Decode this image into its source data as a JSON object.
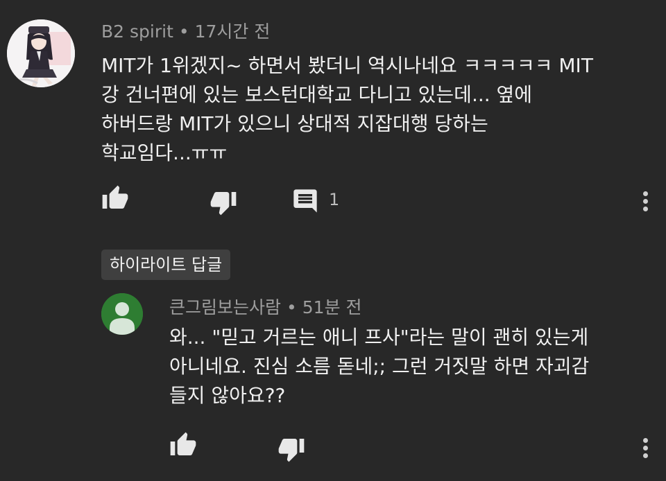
{
  "comment": {
    "author": "B2 spirit",
    "separator": "•",
    "time": "17시간 전",
    "lines": [
      "MIT가 1위겠지~ 하면서 봤더니 역시나네요 ㅋㅋㅋㅋㅋ MIT",
      "강 건너편에 있는 보스턴대학교 다니고 있는데... 옆에",
      "하버드랑 MIT가 있으니 상대적 지잡대행 당하는",
      "학교임다...ㅠㅠ"
    ],
    "reply_count": "1"
  },
  "highlight_label": "하이라이트 답글",
  "reply": {
    "author": "큰그림보는사람",
    "separator": "•",
    "time": "51분 전",
    "lines": [
      "와... \"믿고 거르는 애니 프사\"라는 말이 괜히 있는게",
      "아니네요. 진심 소름 돋네;; 그런 거짓말 하면 자괴감",
      "들지 않아요??"
    ]
  },
  "icons": {
    "like": "thumb-up-icon",
    "dislike": "thumb-down-icon",
    "reply": "comment-icon",
    "more": "more-vertical-icon"
  },
  "colors": {
    "background": "#282828",
    "text": "#f1f1f1",
    "meta": "#9e9e9e",
    "chip": "#3f3f3f",
    "reply_avatar": "#2e7d32"
  }
}
